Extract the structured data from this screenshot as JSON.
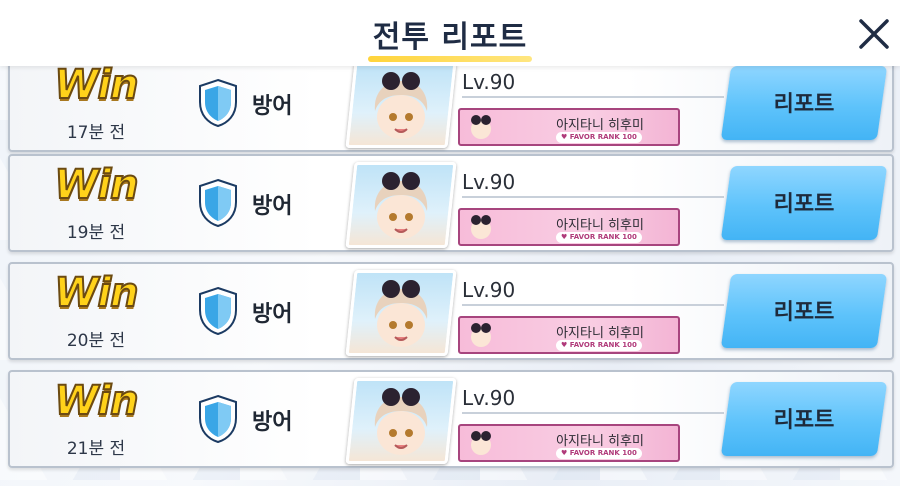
{
  "header": {
    "title": "전투 리포트"
  },
  "rows": [
    {
      "result": "Win",
      "time": "17분 전",
      "type": "방어",
      "level": "Lv.90",
      "character": "아지타니 히후미",
      "favor": "FAVOR RANK 100",
      "report": "리포트"
    },
    {
      "result": "Win",
      "time": "19분 전",
      "type": "방어",
      "level": "Lv.90",
      "character": "아지타니 히후미",
      "favor": "FAVOR RANK 100",
      "report": "리포트"
    },
    {
      "result": "Win",
      "time": "20분 전",
      "type": "방어",
      "level": "Lv.90",
      "character": "아지타니 히후미",
      "favor": "FAVOR RANK 100",
      "report": "리포트"
    },
    {
      "result": "Win",
      "time": "21분 전",
      "type": "방어",
      "level": "Lv.90",
      "character": "아지타니 히후미",
      "favor": "FAVOR RANK 100",
      "report": "리포트"
    }
  ],
  "colors": {
    "accent_yellow": "#ffd43b",
    "report_button": "#5ec3fb",
    "shield": "#3aa6e6",
    "favor_bar": "#f7bcd9"
  },
  "icons": {
    "close": "close-icon",
    "shield": "shield-icon",
    "favor": "heart-icon"
  }
}
